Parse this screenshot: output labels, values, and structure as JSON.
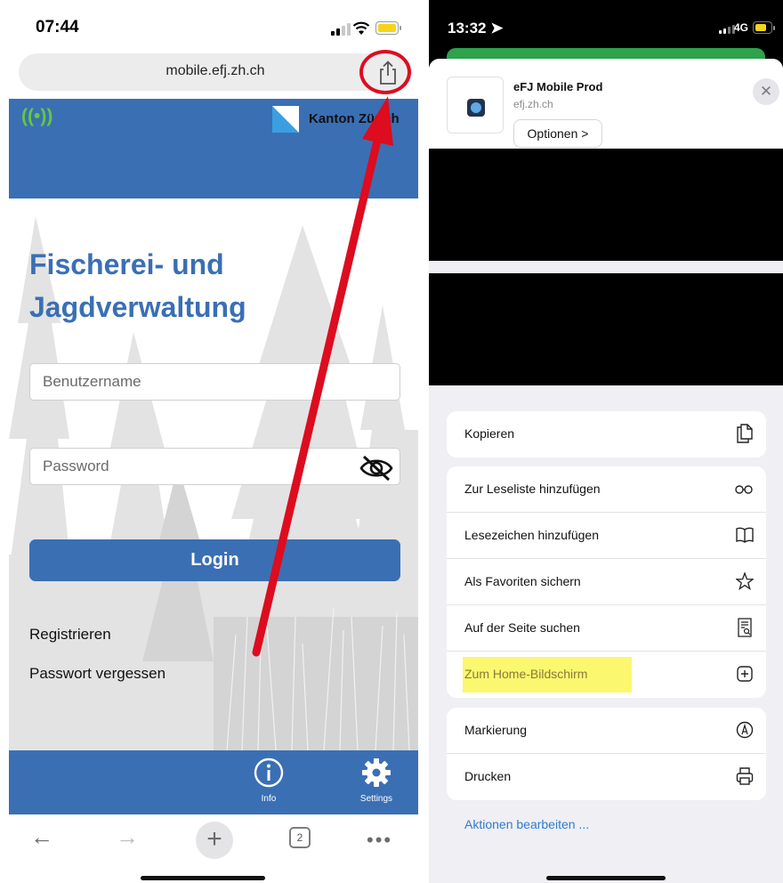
{
  "left": {
    "status": {
      "time": "07:44"
    },
    "address": {
      "url": "mobile.efj.zh.ch"
    },
    "header": {
      "canton": "Kanton Zürich"
    },
    "title_line1": "Fischerei- und",
    "title_line2": "Jagdverwaltung",
    "username_placeholder": "Benutzername",
    "password_placeholder": "Password",
    "login_label": "Login",
    "register_label": "Registrieren",
    "forgot_label": "Passwort vergessen",
    "footer": {
      "info_label": "Info",
      "settings_label": "Settings"
    },
    "toolbar": {
      "tab_count": "2"
    }
  },
  "right": {
    "status": {
      "time": "13:32",
      "network": "4G"
    },
    "app": {
      "name": "eFJ Mobile Prod",
      "domain": "efj.zh.ch",
      "options_label": "Optionen >"
    },
    "actions_group1": [
      {
        "label": "Kopieren",
        "icon": "copy-icon"
      }
    ],
    "actions_group2": [
      {
        "label": "Zur Leseliste hinzufügen",
        "icon": "glasses-icon"
      },
      {
        "label": "Lesezeichen hinzufügen",
        "icon": "book-icon"
      },
      {
        "label": "Als Favoriten sichern",
        "icon": "star-icon"
      },
      {
        "label": "Auf der Seite suchen",
        "icon": "find-in-page-icon"
      },
      {
        "label": "Zum Home-Bildschirm",
        "icon": "add-square-icon",
        "highlighted": true
      }
    ],
    "actions_group3": [
      {
        "label": "Markierung",
        "icon": "markup-icon"
      },
      {
        "label": "Drucken",
        "icon": "printer-icon"
      }
    ],
    "edit_actions_label": "Aktionen bearbeiten ..."
  },
  "colors": {
    "efj_blue": "#3a6fb4",
    "arrow_red": "#dd0c1f",
    "highlight_yellow": "#fbf76f",
    "ios_link_blue": "#2f7bd4",
    "radio_green": "#65c83c"
  }
}
